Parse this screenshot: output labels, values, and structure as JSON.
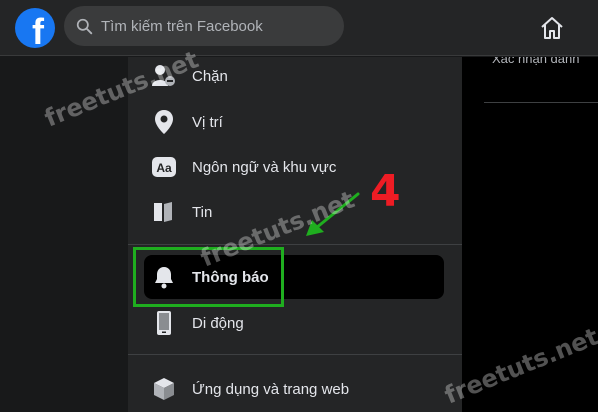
{
  "header": {
    "logo_letter": "f",
    "search_placeholder": "Tìm kiếm trên Facebook",
    "home_icon": "home-icon"
  },
  "right_panel": {
    "truncated_text": "Xác nhận danh"
  },
  "sidebar": {
    "items": [
      {
        "label": "Chặn",
        "icon": "block-user-icon"
      },
      {
        "label": "Vị trí",
        "icon": "location-pin-icon"
      },
      {
        "label": "Ngôn ngữ và khu vực",
        "icon": "language-aa-icon"
      },
      {
        "label": "Tin",
        "icon": "stories-book-icon"
      },
      {
        "label": "Thông báo",
        "icon": "bell-icon",
        "active": true
      },
      {
        "label": "Di động",
        "icon": "mobile-phone-icon"
      },
      {
        "label": "Ứng dụng và trang web",
        "icon": "apps-cube-icon"
      }
    ]
  },
  "annotation": {
    "step_number": "4",
    "highlight_color": "#1fae1f",
    "number_color": "#ee1c24"
  },
  "watermark": {
    "text": "freetuts.net"
  },
  "colors": {
    "fb_blue": "#1877f2",
    "topbar_bg": "#242526",
    "sidebar_bg": "#242526",
    "active_bg": "#000000"
  }
}
